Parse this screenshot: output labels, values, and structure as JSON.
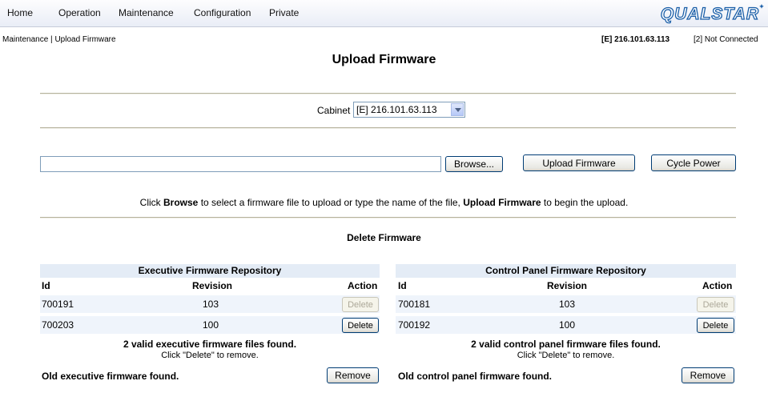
{
  "nav": {
    "items": [
      "Home",
      "Operation",
      "Maintenance",
      "Configuration",
      "Private"
    ],
    "logo_text": "QUALSTAR"
  },
  "breadcrumb": {
    "section": "Maintenance",
    "separator": "|",
    "page": "Upload Firmware"
  },
  "status": {
    "library": "[E] 216.101.63.113",
    "connection": "[2] Not Connected"
  },
  "page_title": "Upload Firmware",
  "cabinet": {
    "label": "Cabinet",
    "selected": "[E] 216.101.63.113"
  },
  "upload": {
    "file_value": "",
    "browse_label": "Browse...",
    "upload_label": "Upload Firmware",
    "cycle_label": "Cycle Power",
    "hint": {
      "p1": "Click ",
      "b1": "Browse",
      "p2": " to select a firmware file to upload or type the name of the file, ",
      "b2": "Upload Firmware",
      "p3": " to begin the upload."
    }
  },
  "delete_title": "Delete Firmware",
  "columns": {
    "id": "Id",
    "revision": "Revision",
    "action": "Action"
  },
  "executive": {
    "title": "Executive Firmware Repository",
    "rows": [
      {
        "id": "700191",
        "revision": "103",
        "action": "Delete",
        "enabled": false
      },
      {
        "id": "700203",
        "revision": "100",
        "action": "Delete",
        "enabled": true
      }
    ],
    "found": "2 valid executive firmware files found.",
    "hint": "Click \"Delete\" to remove.",
    "old": "Old executive firmware found.",
    "remove": "Remove"
  },
  "control_panel": {
    "title": "Control Panel Firmware Repository",
    "rows": [
      {
        "id": "700181",
        "revision": "103",
        "action": "Delete",
        "enabled": false
      },
      {
        "id": "700192",
        "revision": "100",
        "action": "Delete",
        "enabled": true
      }
    ],
    "found": "2 valid control panel firmware files found.",
    "hint": "Click \"Delete\" to remove.",
    "old": "Old control panel firmware found.",
    "remove": "Remove"
  },
  "colors": {
    "accent": "#1b5fa8",
    "repo_header_bg": "#e4ecf6",
    "row_bg": "#eff4fb",
    "rule": "#b6b39d"
  }
}
